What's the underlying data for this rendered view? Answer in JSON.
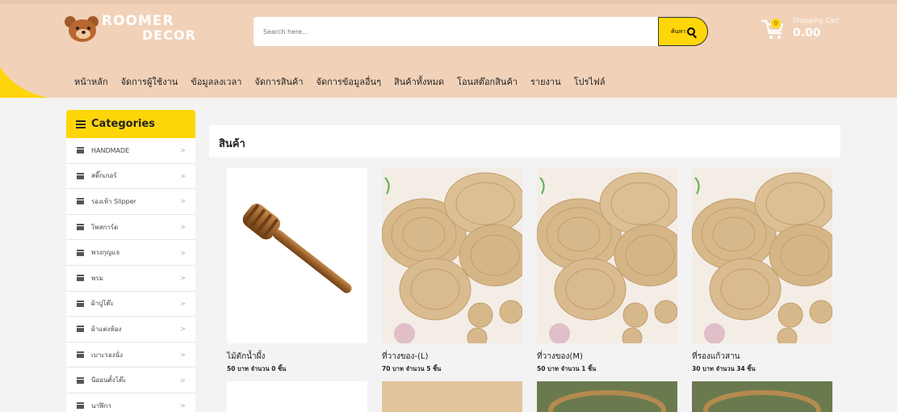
{
  "brand": {
    "line1": "ROOMER",
    "line2": "DECOR"
  },
  "search": {
    "placeholder": "Search here...",
    "button_label": "ค้นหา"
  },
  "cart": {
    "label": "Shopping Cart",
    "amount": "0.00",
    "count": "0"
  },
  "nav": [
    "หน้าหลัก",
    "จัดการผู้ใช้งาน",
    "ข้อมูลลงเวลา",
    "จัดการสินค้า",
    "จัดการข้อมูลอื่นๆ",
    "สินค้าทั้งหมด",
    "โอนสต๊อกสินค้า",
    "รายงาน",
    "โปรไฟล์"
  ],
  "sidebar": {
    "title": "Categories",
    "items": [
      "HANDMADE",
      "สติ๊กเกอร์",
      "รองเท้า Slipper",
      "โพสการ์ด",
      "พวงกุญแจ",
      "พรม",
      "ผ้าปูโต๊ะ",
      "ผ้าแต่งห้อง",
      "เบาะรองนั่ง",
      "นีออนตั้งโต๊ะ",
      "นาฬิกา"
    ]
  },
  "main": {
    "title": "สินค้า"
  },
  "products": [
    {
      "name": "ไม้ตักน้ำผึ้ง",
      "price": "50 บาท จำนวน 0  ชิ้น"
    },
    {
      "name": "ที่วางของ-(L)",
      "price": "70 บาท จำนวน 5  ชิ้น"
    },
    {
      "name": "ที่วางของ(M)",
      "price": "50 บาท จำนวน 1  ชิ้น"
    },
    {
      "name": "ที่รองแก้วสาน",
      "price": "30 บาท จำนวน 34  ชิ้น"
    }
  ],
  "colors": {
    "header_bg": "#f1d2b9",
    "accent": "#ffd60a",
    "page_bg": "#f3f3f3"
  }
}
